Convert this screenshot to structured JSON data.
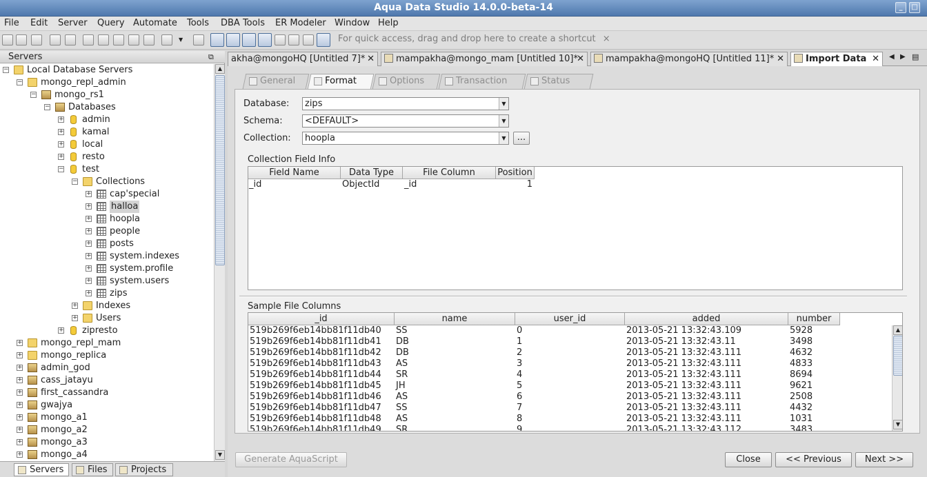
{
  "window": {
    "title": "Aqua Data Studio 14.0.0-beta-14"
  },
  "menu": [
    "File",
    "Edit",
    "Server",
    "Query",
    "Automate",
    "Tools",
    "DBA Tools",
    "ER Modeler",
    "Window",
    "Help"
  ],
  "toolbar": {
    "shortcut_hint": "For quick access, drag and drop here to create a shortcut",
    "shortcut_close": "×"
  },
  "left_panel": {
    "title": "Servers",
    "tree": [
      {
        "label": "Local Database Servers",
        "level": 0,
        "icon": "root-folder-icon",
        "expander": "minus"
      },
      {
        "label": "mongo_repl_admin",
        "level": 1,
        "icon": "folder-icon",
        "expander": "minus"
      },
      {
        "label": "mongo_rs1",
        "level": 2,
        "icon": "server-icon",
        "expander": "minus"
      },
      {
        "label": "Databases",
        "level": 3,
        "icon": "databases-icon",
        "expander": "minus"
      },
      {
        "label": "admin",
        "level": 4,
        "icon": "database-icon",
        "expander": "plus"
      },
      {
        "label": "kamal",
        "level": 4,
        "icon": "database-icon",
        "expander": "plus"
      },
      {
        "label": "local",
        "level": 4,
        "icon": "database-icon",
        "expander": "plus"
      },
      {
        "label": "resto",
        "level": 4,
        "icon": "database-icon",
        "expander": "plus"
      },
      {
        "label": "test",
        "level": 4,
        "icon": "database-icon",
        "expander": "minus"
      },
      {
        "label": "Collections",
        "level": 5,
        "icon": "folder-icon",
        "expander": "minus"
      },
      {
        "label": "cap'special",
        "level": 6,
        "icon": "table-icon",
        "expander": "plus"
      },
      {
        "label": "halloa",
        "level": 6,
        "icon": "table-icon",
        "expander": "plus",
        "selected": true
      },
      {
        "label": "hoopla",
        "level": 6,
        "icon": "table-icon",
        "expander": "plus"
      },
      {
        "label": "people",
        "level": 6,
        "icon": "table-icon",
        "expander": "plus"
      },
      {
        "label": "posts",
        "level": 6,
        "icon": "table-icon",
        "expander": "plus"
      },
      {
        "label": "system.indexes",
        "level": 6,
        "icon": "table-icon",
        "expander": "plus"
      },
      {
        "label": "system.profile",
        "level": 6,
        "icon": "table-icon",
        "expander": "plus"
      },
      {
        "label": "system.users",
        "level": 6,
        "icon": "table-icon",
        "expander": "plus"
      },
      {
        "label": "zips",
        "level": 6,
        "icon": "table-icon",
        "expander": "plus"
      },
      {
        "label": "Indexes",
        "level": 5,
        "icon": "folder-icon",
        "expander": "plus"
      },
      {
        "label": "Users",
        "level": 5,
        "icon": "folder-icon",
        "expander": "plus"
      },
      {
        "label": "zipresto",
        "level": 4,
        "icon": "database-icon",
        "expander": "plus"
      },
      {
        "label": "mongo_repl_mam",
        "level": 1,
        "icon": "folder-icon",
        "expander": "plus"
      },
      {
        "label": "mongo_replica",
        "level": 1,
        "icon": "folder-icon",
        "expander": "plus"
      },
      {
        "label": "admin_god",
        "level": 1,
        "icon": "server-icon",
        "expander": "plus"
      },
      {
        "label": "cass_jatayu",
        "level": 1,
        "icon": "server-icon",
        "expander": "plus"
      },
      {
        "label": "first_cassandra",
        "level": 1,
        "icon": "server-icon",
        "expander": "plus"
      },
      {
        "label": "gwajya",
        "level": 1,
        "icon": "server-icon",
        "expander": "plus"
      },
      {
        "label": "mongo_a1",
        "level": 1,
        "icon": "server-icon",
        "expander": "plus"
      },
      {
        "label": "mongo_a2",
        "level": 1,
        "icon": "server-icon",
        "expander": "plus"
      },
      {
        "label": "mongo_a3",
        "level": 1,
        "icon": "server-icon",
        "expander": "plus"
      },
      {
        "label": "mongo_a4",
        "level": 1,
        "icon": "server-icon",
        "expander": "plus"
      }
    ],
    "bottom_tabs": [
      "Servers",
      "Files",
      "Projects"
    ]
  },
  "editor_tabs": [
    {
      "label": "akha@mongoHQ [Untitled 7]*",
      "close": "✕"
    },
    {
      "label": "mampakha@mongo_mam [Untitled 10]*",
      "close": "✕"
    },
    {
      "label": "mampakha@mongoHQ [Untitled 11]*",
      "close": "✕"
    },
    {
      "label": "Import Data",
      "close": "✕",
      "selected": true
    }
  ],
  "wizard_tabs": [
    "General",
    "Format",
    "Options",
    "Transaction",
    "Status"
  ],
  "form": {
    "database_label": "Database:",
    "database_value": "zips",
    "schema_label": "Schema:",
    "schema_value": "<DEFAULT>",
    "collection_label": "Collection:",
    "collection_value": "hoopla",
    "browse_label": "..."
  },
  "field_info": {
    "title": "Collection Field Info",
    "columns": [
      "Field Name",
      "Data Type",
      "File Column",
      "Position"
    ],
    "rows": [
      [
        "_id",
        "ObjectId",
        "_id",
        "1"
      ]
    ]
  },
  "sample": {
    "title": "Sample File Columns",
    "columns": [
      "_id",
      "name",
      "user_id",
      "added",
      "number"
    ],
    "rows": [
      [
        "519b269f6eb14bb81f11db40",
        "SS",
        "0",
        "2013-05-21 13:32:43.109",
        "5928"
      ],
      [
        "519b269f6eb14bb81f11db41",
        "DB",
        "1",
        "2013-05-21 13:32:43.11",
        "3498"
      ],
      [
        "519b269f6eb14bb81f11db42",
        "DB",
        "2",
        "2013-05-21 13:32:43.111",
        "4632"
      ],
      [
        "519b269f6eb14bb81f11db43",
        "AS",
        "3",
        "2013-05-21 13:32:43.111",
        "4833"
      ],
      [
        "519b269f6eb14bb81f11db44",
        "SR",
        "4",
        "2013-05-21 13:32:43.111",
        "8694"
      ],
      [
        "519b269f6eb14bb81f11db45",
        "JH",
        "5",
        "2013-05-21 13:32:43.111",
        "9621"
      ],
      [
        "519b269f6eb14bb81f11db46",
        "AS",
        "6",
        "2013-05-21 13:32:43.111",
        "2508"
      ],
      [
        "519b269f6eb14bb81f11db47",
        "SS",
        "7",
        "2013-05-21 13:32:43.111",
        "4432"
      ],
      [
        "519b269f6eb14bb81f11db48",
        "AS",
        "8",
        "2013-05-21 13:32:43.111",
        "1031"
      ],
      [
        "519b269f6eb14bb81f11db49",
        "SR",
        "9",
        "2013-05-21 13:32:43.112",
        "3483"
      ]
    ]
  },
  "buttons": {
    "generate": "Generate AquaScript",
    "close": "Close",
    "previous": "<< Previous",
    "next": "Next >>"
  }
}
